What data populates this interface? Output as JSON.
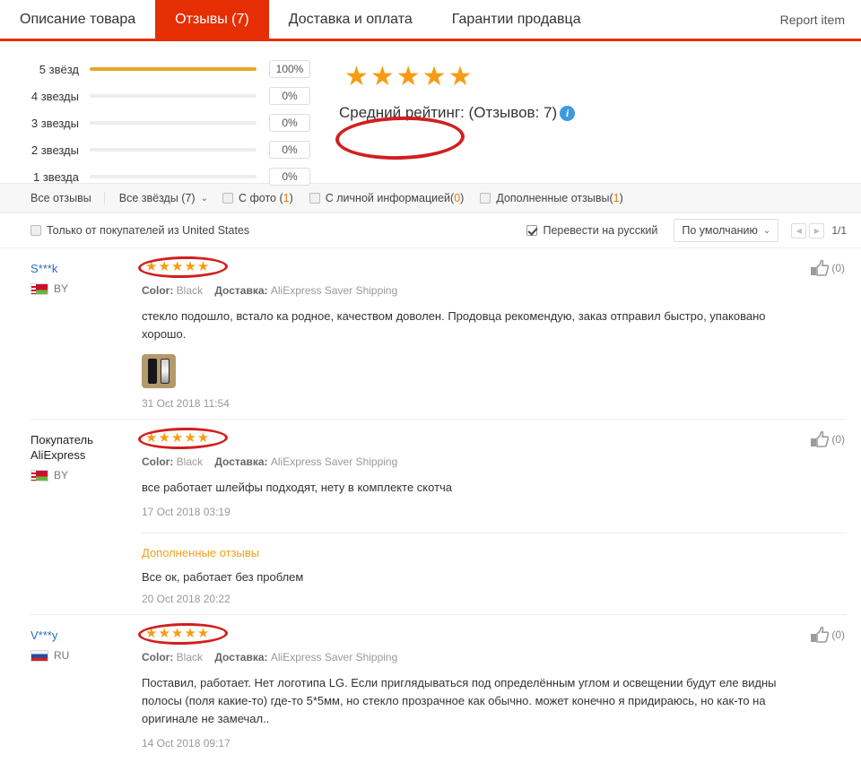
{
  "tabs": [
    {
      "label": "Описание товара",
      "active": false
    },
    {
      "label": "Отзывы (7)",
      "active": true
    },
    {
      "label": "Доставка и оплата",
      "active": false
    },
    {
      "label": "Гарантии продавца",
      "active": false
    }
  ],
  "report_label": "Report item",
  "summary": {
    "bars": [
      {
        "label": "5 звёзд",
        "percent": "100%",
        "value": 100
      },
      {
        "label": "4 звезды",
        "percent": "0%",
        "value": 0
      },
      {
        "label": "3 звезды",
        "percent": "0%",
        "value": 0
      },
      {
        "label": "2 звезды",
        "percent": "0%",
        "value": 0
      },
      {
        "label": "1 звезда",
        "percent": "0%",
        "value": 0
      }
    ],
    "avg_stars": "★★★★★",
    "avg_label": "Средний рейтинг:  (Отзывов: 7)",
    "info_icon": "info-icon",
    "accent_star_color": "#f79c12",
    "bar_fill_color": "#e8a723",
    "annotation_color": "#d21f1f"
  },
  "filters": {
    "all_reviews": "Все отзывы",
    "all_stars": "Все звёзды (7)",
    "caret": "⌄",
    "with_photo_label": "С фото (",
    "with_photo_count": "1",
    "with_photo_close": ")",
    "with_personal_label": "С личной информацией(",
    "with_personal_count": "0",
    "with_personal_close": ")",
    "additional_label": "Дополненные отзывы(",
    "additional_count": "1",
    "additional_close": ")"
  },
  "row2": {
    "buyers_only": "Только от покупателей из United States",
    "translate": "Перевести на русский",
    "translate_checked": true,
    "sort_value": "По умолчанию",
    "sort_caret": "⌄",
    "prev_icon": "◀",
    "next_icon": "▶",
    "page_text": "1/1"
  },
  "reviews": [
    {
      "user": "S***k",
      "user_is_link": true,
      "country_code": "BY",
      "flag": "flag-belarus",
      "stars": "★★★★★",
      "color_key": "Color:",
      "color_value": "Black",
      "shipping_key": "Доставка:",
      "shipping_value": "AliExpress Saver Shipping",
      "text": "стекло подошло, встало ка родное, качеством доволен. Продовца рекомендую, заказ отправил быстро, упаковано хорошо.",
      "has_photo": true,
      "date": "31 Oct 2018 11:54",
      "likes": "(0)",
      "addon": null
    },
    {
      "user": "Покупатель AliExpress",
      "user_is_link": false,
      "country_code": "BY",
      "flag": "flag-belarus",
      "stars": "★★★★★",
      "color_key": "Color:",
      "color_value": "Black",
      "shipping_key": "Доставка:",
      "shipping_value": "AliExpress Saver Shipping",
      "text": "все работает шлейфы подходят, нету в комплекте скотча",
      "has_photo": false,
      "date": "17 Oct 2018 03:19",
      "likes": "(0)",
      "addon": {
        "title": "Дополненные отзывы",
        "text": "Все ок, работает без проблем",
        "date": "20 Oct 2018 20:22"
      }
    },
    {
      "user": "V***y",
      "user_is_link": true,
      "country_code": "RU",
      "flag": "flag-russia",
      "stars": "★★★★★",
      "color_key": "Color:",
      "color_value": "Black",
      "shipping_key": "Доставка:",
      "shipping_value": "AliExpress Saver Shipping",
      "text": "Поставил, работает. Нет логотипа LG. Если приглядываться под определённым углом и освещении будут еле видны полосы (поля какие-то) где-то 5*5мм, но стекло прозрачное как обычно. может конечно я придираюсь, но как-то на оригинале не замечал..",
      "has_photo": false,
      "date": "14 Oct 2018 09:17",
      "likes": "(0)",
      "addon": null
    }
  ]
}
